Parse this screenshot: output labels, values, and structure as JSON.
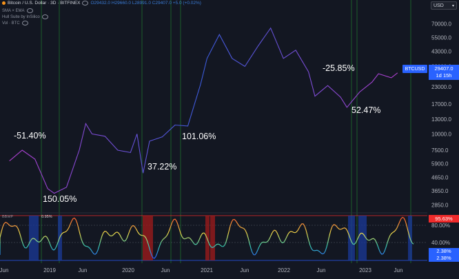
{
  "header": {
    "title": "Bitcoin / U.S. Dollar · 3D · BITFINEX",
    "ohlc": "O29432.0 H29660.0 L28991.0 C29407.0 +5.0 (+0.02%)",
    "indicators": [
      "SMA × EMA",
      "Hull Suite by InSilico",
      "Vol · BTC"
    ]
  },
  "currency_selector": {
    "value": "USD"
  },
  "symbol_tag": {
    "label": "BTCUSD"
  },
  "last_price": {
    "price": "29407.0",
    "countdown": "1d 15h"
  },
  "indicator_panel": {
    "name": "BBWP",
    "value": "0.95%",
    "high_tag": "95.63%",
    "low_tags": [
      "2.38%",
      "2.38%"
    ],
    "levels": [
      "80.00%",
      "40.00%"
    ]
  },
  "price_axis": {
    "ticks": [
      "70000.0",
      "55000.0",
      "43000.0",
      "33000.0",
      "23000.0",
      "17000.0",
      "13000.0",
      "10000.0",
      "7500.0",
      "5900.0",
      "4650.0",
      "3650.0",
      "2850.0"
    ]
  },
  "time_axis": {
    "ticks": [
      "Jun",
      "2019",
      "Jun",
      "2020",
      "Jun",
      "2021",
      "Jun",
      "2022",
      "Jun",
      "2023",
      "Jun"
    ]
  },
  "annotations": [
    "-51.40%",
    "150.05%",
    "37.22%",
    "101.06%",
    "-25.85%",
    "52.47%"
  ],
  "colors": {
    "background": "#131722",
    "price_up": "#3b5bdb",
    "price_down": "#b03fcf",
    "accent": "#2962ff",
    "alert": "#ef2b2b",
    "cycle_line": "#1f6f2c"
  },
  "chart_data": {
    "type": "line",
    "scale": "log",
    "x": [
      "2018-06",
      "2018-08",
      "2018-10",
      "2018-12",
      "2019-01",
      "2019-03",
      "2019-05",
      "2019-06",
      "2019-07",
      "2019-09",
      "2019-11",
      "2020-01",
      "2020-02",
      "2020-03",
      "2020-04",
      "2020-06",
      "2020-08",
      "2020-10",
      "2020-12",
      "2021-01",
      "2021-03",
      "2021-05",
      "2021-07",
      "2021-09",
      "2021-11",
      "2022-01",
      "2022-03",
      "2022-05",
      "2022-06",
      "2022-08",
      "2022-10",
      "2022-11",
      "2023-01",
      "2023-03",
      "2023-04",
      "2023-06",
      "2023-07"
    ],
    "series": [
      {
        "values": [
          6200,
          7500,
          6400,
          3800,
          3500,
          3900,
          7500,
          12000,
          10000,
          9600,
          7500,
          7200,
          10000,
          5000,
          8800,
          9500,
          11700,
          11500,
          24000,
          38000,
          58000,
          38000,
          33000,
          47000,
          65000,
          38000,
          44000,
          30000,
          19500,
          23500,
          19200,
          16000,
          21000,
          25000,
          29000,
          27000,
          29407
        ]
      }
    ],
    "xlabel": "",
    "ylabel": "",
    "ylim": [
      2600,
      90000
    ],
    "grid": false
  }
}
